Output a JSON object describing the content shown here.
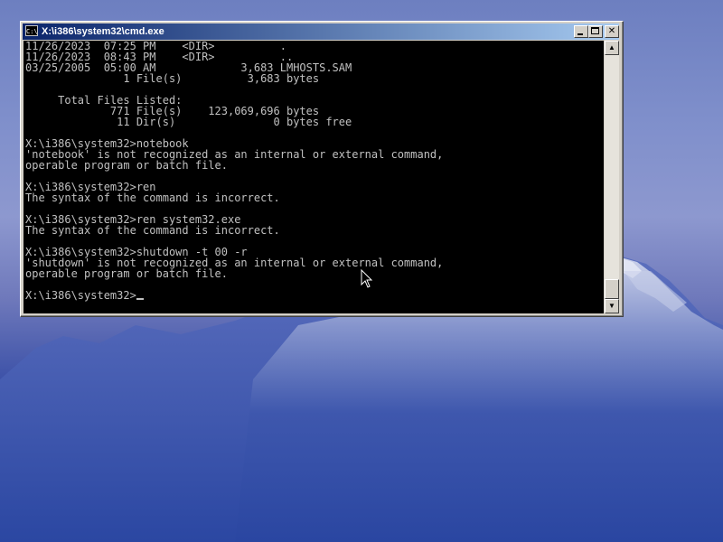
{
  "window": {
    "title": "X:\\i386\\system32\\cmd.exe",
    "icon_label": "C:\\",
    "buttons": {
      "minimize": "minimize-icon",
      "maximize": "maximize-icon",
      "close": "✕"
    }
  },
  "console": {
    "lines": [
      "11/26/2023  07:25 PM    <DIR>          .",
      "11/26/2023  08:43 PM    <DIR>          ..",
      "03/25/2005  05:00 AM             3,683 LMHOSTS.SAM",
      "               1 File(s)          3,683 bytes",
      "",
      "     Total Files Listed:",
      "             771 File(s)    123,069,696 bytes",
      "              11 Dir(s)               0 bytes free",
      "",
      "X:\\i386\\system32>notebook",
      "'notebook' is not recognized as an internal or external command,",
      "operable program or batch file.",
      "",
      "X:\\i386\\system32>ren",
      "The syntax of the command is incorrect.",
      "",
      "X:\\i386\\system32>ren system32.exe",
      "The syntax of the command is incorrect.",
      "",
      "X:\\i386\\system32>shutdown -t 00 -r",
      "'shutdown' is not recognized as an internal or external command,",
      "operable program or batch file.",
      ""
    ],
    "prompt": "X:\\i386\\system32>",
    "input": ""
  },
  "scrollbar": {
    "up": "▲",
    "down": "▼"
  },
  "colors": {
    "titlebar_start": "#0a246a",
    "titlebar_end": "#a6caf0",
    "console_bg": "#000000",
    "console_fg": "#c0c0c0"
  }
}
